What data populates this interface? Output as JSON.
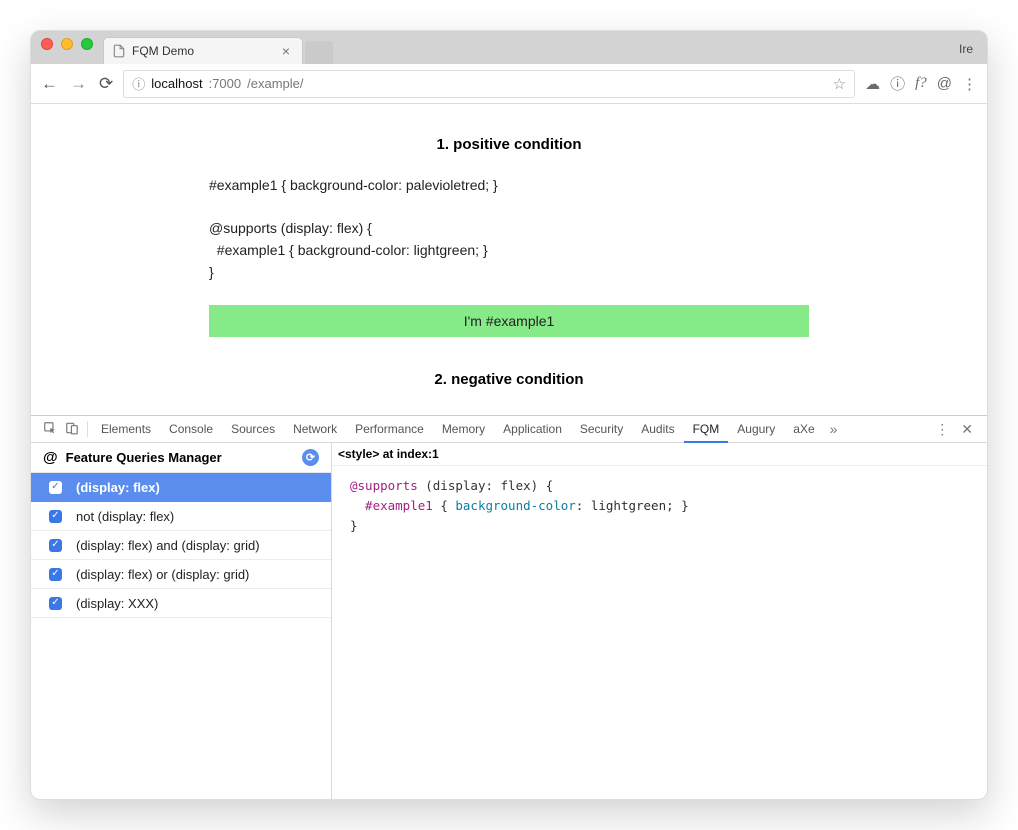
{
  "tab": {
    "title": "FQM Demo",
    "user": "Ire"
  },
  "toolbar": {
    "url_host": "localhost",
    "url_port": ":7000",
    "url_path": "/example/"
  },
  "page": {
    "heading1": "1. positive condition",
    "code1": "#example1 { background-color: palevioletred; }\n\n@supports (display: flex) {\n  #example1 { background-color: lightgreen; }\n}",
    "example1_label": "I'm #example1",
    "heading2": "2. negative condition"
  },
  "devtools": {
    "tabs": [
      "Elements",
      "Console",
      "Sources",
      "Network",
      "Performance",
      "Memory",
      "Application",
      "Security",
      "Audits",
      "FQM",
      "Augury",
      "aXe"
    ],
    "active_tab": "FQM",
    "panel_title": "Feature Queries Manager",
    "queries": [
      {
        "label": "(display: flex)",
        "checked": true,
        "selected": true
      },
      {
        "label": "not (display: flex)",
        "checked": true,
        "selected": false
      },
      {
        "label": "(display: flex) and (display: grid)",
        "checked": true,
        "selected": false
      },
      {
        "label": "(display: flex) or (display: grid)",
        "checked": true,
        "selected": false
      },
      {
        "label": "(display: XXX)",
        "checked": true,
        "selected": false
      }
    ],
    "style_header": "<style> at index:1",
    "style_code": {
      "line1_at": "@supports",
      "line1_cond": " (display: flex) {",
      "line2_sel": "  #example1",
      "line2_mid": " { ",
      "line2_prop": "background-color",
      "line2_rest": ": lightgreen; }",
      "line3": "}"
    }
  }
}
